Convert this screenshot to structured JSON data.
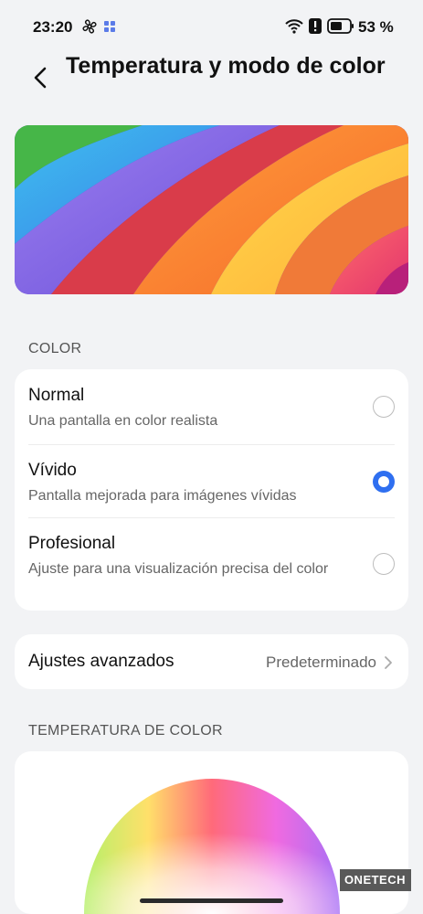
{
  "status": {
    "time": "23:20",
    "battery": "53 %"
  },
  "header": {
    "title": "Temperatura y modo de color"
  },
  "color_section": {
    "label": "COLOR",
    "options": [
      {
        "title": "Normal",
        "desc": "Una pantalla en color realista",
        "selected": false
      },
      {
        "title": "Vívido",
        "desc": "Pantalla mejorada para imágenes vívidas",
        "selected": true
      },
      {
        "title": "Profesional",
        "desc": "Ajuste para una visualización precisa del color",
        "selected": false
      }
    ]
  },
  "advanced": {
    "label": "Ajustes avanzados",
    "value": "Predeterminado"
  },
  "temperature_section": {
    "label": "TEMPERATURA DE COLOR"
  },
  "watermark": "ONETECH",
  "colors": {
    "accent": "#2f6ff0",
    "background": "#f2f3f5",
    "card": "#ffffff"
  }
}
